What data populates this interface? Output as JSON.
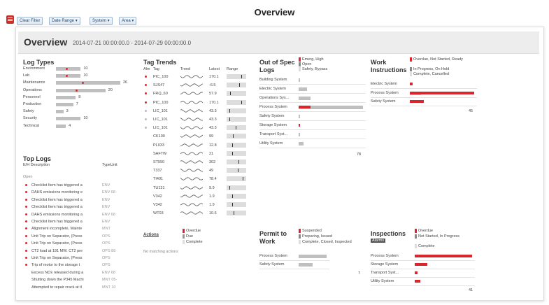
{
  "page_title": "Overview",
  "filters": {
    "clear": "Clear Filter",
    "date_range": "Date Range ▾",
    "system": "System ▾",
    "area": "Area ▾"
  },
  "header": {
    "title": "Overview",
    "range": "2014-07-21 00:00:00.0  -  2014-07-29 00:00:00.0"
  },
  "log_types": {
    "title": "Log Types",
    "items": [
      {
        "name": "Environment",
        "count": "10",
        "value": 10
      },
      {
        "name": "Lab",
        "count": "10",
        "value": 10
      },
      {
        "name": "Maintenance",
        "count": "26",
        "value": 26
      },
      {
        "name": "Operations",
        "count": "20",
        "value": 20
      },
      {
        "name": "Personnel",
        "count": "8",
        "value": 8
      },
      {
        "name": "Production",
        "count": "7",
        "value": 7
      },
      {
        "name": "Safety",
        "count": "3",
        "value": 3
      },
      {
        "name": "Security",
        "count": "10",
        "value": 10
      },
      {
        "name": "Technical",
        "count": "4",
        "value": 4
      }
    ]
  },
  "tag_trends": {
    "title": "Tag Trends",
    "cols": {
      "alm": "Alm",
      "tag": "Tag",
      "trend": "Trend",
      "latest": "Latest",
      "range": "Range"
    },
    "rows": [
      {
        "alm": "red",
        "tag": "PIC_100",
        "latest": "170.1",
        "pos": 0.8
      },
      {
        "alm": "red",
        "tag": "SJS47",
        "latest": "-6.5",
        "pos": 0.7
      },
      {
        "alm": "red",
        "tag": "FRQ_60",
        "latest": "57.9",
        "pos": 0.2
      },
      {
        "alm": "red",
        "tag": "PIC_100",
        "latest": "170.1",
        "pos": 0.8
      },
      {
        "alm": "grey",
        "tag": "LIC_101",
        "latest": "43.3",
        "pos": 0.15
      },
      {
        "alm": "grey",
        "tag": "LIC_101",
        "latest": "43.3",
        "pos": 0.15
      },
      {
        "alm": "grey",
        "tag": "LIC_101",
        "latest": "43.3",
        "pos": 0.5
      },
      {
        "alm": "",
        "tag": "CK100",
        "latest": "99",
        "pos": 0.35
      },
      {
        "alm": "",
        "tag": "PL033",
        "latest": "12.8",
        "pos": 0.3
      },
      {
        "alm": "",
        "tag": "SAFTW",
        "latest": "21",
        "pos": 0.3
      },
      {
        "alm": "",
        "tag": "ST550",
        "latest": "302",
        "pos": 0.65
      },
      {
        "alm": "",
        "tag": "T337",
        "latest": "49",
        "pos": 0.6
      },
      {
        "alm": "",
        "tag": "TI401",
        "latest": "78.4",
        "pos": 0.9
      },
      {
        "alm": "",
        "tag": "TU131",
        "latest": "9.9",
        "pos": 0.15
      },
      {
        "alm": "",
        "tag": "V342",
        "latest": "1.9",
        "pos": 0.3
      },
      {
        "alm": "",
        "tag": "V342",
        "latest": "1.9",
        "pos": 0.3
      },
      {
        "alm": "",
        "tag": "WT03",
        "latest": "10.6",
        "pos": 0.4
      }
    ]
  },
  "out_of_spec": {
    "title1": "Out of Spec",
    "title2": "Logs",
    "legend": [
      "Emerg, High",
      "Open",
      "Safety, Bypass"
    ],
    "rows": [
      {
        "name": "Building System",
        "red": 0,
        "grey": 2
      },
      {
        "name": "Electric System",
        "red": 0,
        "grey": 10
      },
      {
        "name": "Operations Sys...",
        "red": 0,
        "grey": 14
      },
      {
        "name": "Process System",
        "red": 14,
        "grey": 78
      },
      {
        "name": "Safety System",
        "red": 0,
        "grey": 2
      },
      {
        "name": "Storage System",
        "red": 2,
        "grey": 0
      },
      {
        "name": "Transport Syst...",
        "red": 0,
        "grey": 2
      },
      {
        "name": "Utility System",
        "red": 0,
        "grey": 6
      }
    ],
    "total": "78"
  },
  "work": {
    "title1": "Work",
    "title2": "Instructions",
    "legend": [
      "Overdue, Not Started, Ready",
      "In Progress, On Hold",
      "Complete, Cancelled"
    ],
    "rows": [
      {
        "name": "Electric System",
        "red": 2,
        "grey": 0
      },
      {
        "name": "Process System",
        "red": 45,
        "grey": 8
      },
      {
        "name": "Safety System",
        "red": 10,
        "grey": 0
      }
    ],
    "total": "45"
  },
  "top_logs": {
    "title": "Top Logs",
    "col_eh": "E/H Description",
    "col_type": "TypeUnit",
    "group": "Open",
    "rows": [
      {
        "dot": "red",
        "desc": "Checklist Item has triggered a",
        "type": "ENV"
      },
      {
        "dot": "red",
        "desc": "DAHS emissions monitoring e",
        "type": "ENV 68"
      },
      {
        "dot": "red",
        "desc": "Checklist Item has triggered a",
        "type": "ENV"
      },
      {
        "dot": "red",
        "desc": "Checklist Item has triggered a",
        "type": "ENV"
      },
      {
        "dot": "red",
        "desc": "DAHS emissions monitoring a",
        "type": "ENV 68"
      },
      {
        "dot": "red",
        "desc": "Checklist Item has triggered a",
        "type": "ENV"
      },
      {
        "dot": "red",
        "desc": "Alignment incomplete, Mainte",
        "type": "MNT"
      },
      {
        "dot": "red",
        "desc": "Unit Trip on Separator, (Press",
        "type": "OPS"
      },
      {
        "dot": "red",
        "desc": "Unit Trip on Separator, (Press",
        "type": "OPS"
      },
      {
        "dot": "red",
        "desc": "CT2 load at 191 MW. CT2 pre",
        "type": "OPS 88"
      },
      {
        "dot": "red",
        "desc": "Unit Trip on Separator, (Press",
        "type": "OPS"
      },
      {
        "dot": "red",
        "desc": "Trip of motor to the storage t",
        "type": "OPS"
      },
      {
        "dot": "",
        "desc": "Excess NOx released during a",
        "type": "ENV 68"
      },
      {
        "dot": "",
        "desc": "Shutting down the P345 Machi",
        "type": "MNT 05-"
      },
      {
        "dot": "",
        "desc": "Attempted to repair crack at tl",
        "type": "MNT 10"
      }
    ]
  },
  "actions": {
    "title": "Actions",
    "legend": [
      "Overdue",
      "Due",
      "Complete"
    ],
    "empty": "No matching actions"
  },
  "permit": {
    "title1": "Permit to",
    "title2": "Work",
    "legend": [
      "Suspended",
      "Preparing, Issued",
      "Complete, Closed, Inspected"
    ],
    "rows": [
      {
        "name": "Process System",
        "grey": 80
      },
      {
        "name": "Safety System",
        "grey": 40
      }
    ],
    "total": "7"
  },
  "inspections": {
    "title": "Inspections",
    "tag": "Alarms",
    "legend": [
      "Overdue",
      "Not Started, In Progress",
      "Complete"
    ],
    "rows": [
      {
        "name": "Process System",
        "red": 80,
        "grey": 0
      },
      {
        "name": "Storage System",
        "red": 18,
        "grey": 0
      },
      {
        "name": "Transport Syst...",
        "red": 4,
        "grey": 0
      },
      {
        "name": "Utility System",
        "red": 8,
        "grey": 0
      }
    ],
    "total": "41"
  },
  "colors": {
    "red": "#d9262c",
    "grey": "#bfbfbf",
    "button_border": "#9fb6cf"
  }
}
